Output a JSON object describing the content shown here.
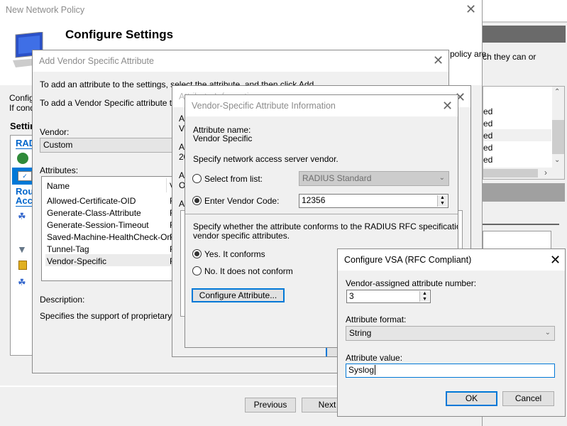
{
  "background_window": {
    "text": "ch they can or",
    "list_items": [
      "ed",
      "ed",
      "ed",
      "ed",
      "ed"
    ]
  },
  "main": {
    "title": "New Network Policy",
    "heading": "Configure Settings",
    "intro1": "Configu",
    "intro2": "If cond",
    "intro_right": "policy are",
    "settings_label": "Settin",
    "sidebar": {
      "section1": "RAD",
      "section2a": "Rou",
      "section2b": "Acc"
    },
    "previous": "Previous",
    "next": "Next"
  },
  "vsa_add": {
    "title": "Add Vendor Specific Attribute",
    "line1": "To add an attribute to the settings, select the attribute, and then click Add.",
    "line2": "To add a Vendor Specific attribute that i",
    "vendor_label": "Vendor:",
    "vendor_value": "Custom",
    "attributes_label": "Attributes:",
    "columns": [
      "Name",
      "V"
    ],
    "rows": [
      {
        "name": "Allowed-Certificate-OID",
        "v": "R"
      },
      {
        "name": "Generate-Class-Attribute",
        "v": "R"
      },
      {
        "name": "Generate-Session-Timeout",
        "v": "R"
      },
      {
        "name": "Saved-Machine-HealthCheck-Only",
        "v": "R"
      },
      {
        "name": "Tunnel-Tag",
        "v": "R"
      },
      {
        "name": "Vendor-Specific",
        "v": "R"
      }
    ],
    "selected_row": 5,
    "description_label": "Description:",
    "description": "Specifies the support of proprietary NAS"
  },
  "attr_info": {
    "title": "Attribute Information",
    "frag": [
      "At",
      "Ve",
      "At",
      "20",
      "At",
      "O",
      "At"
    ]
  },
  "vendor_info": {
    "title": "Vendor-Specific Attribute Information",
    "attr_name_label": "Attribute name:",
    "attr_name": "Vendor Specific",
    "specify": "Specify network access server vendor.",
    "select_from_list": "Select from list:",
    "select_value": "RADIUS Standard",
    "enter_code": "Enter Vendor Code:",
    "code_value": "12356",
    "conform_text1": "Specify whether the attribute conforms to the RADIUS RFC specification for",
    "conform_text2": "vendor specific attributes.",
    "yes": "Yes. It conforms",
    "no": "No. It does not conform",
    "configure_btn": "Configure Attribute..."
  },
  "vsa_config": {
    "title": "Configure VSA (RFC Compliant)",
    "number_label": "Vendor-assigned attribute number:",
    "number_value": "3",
    "format_label": "Attribute format:",
    "format_value": "String",
    "value_label": "Attribute value:",
    "value": "Syslog",
    "ok": "OK",
    "cancel": "Cancel"
  },
  "colors": {
    "accent": "#0078d7",
    "sidebar_selected": "#0078d7",
    "link_header": "#0066cc"
  }
}
